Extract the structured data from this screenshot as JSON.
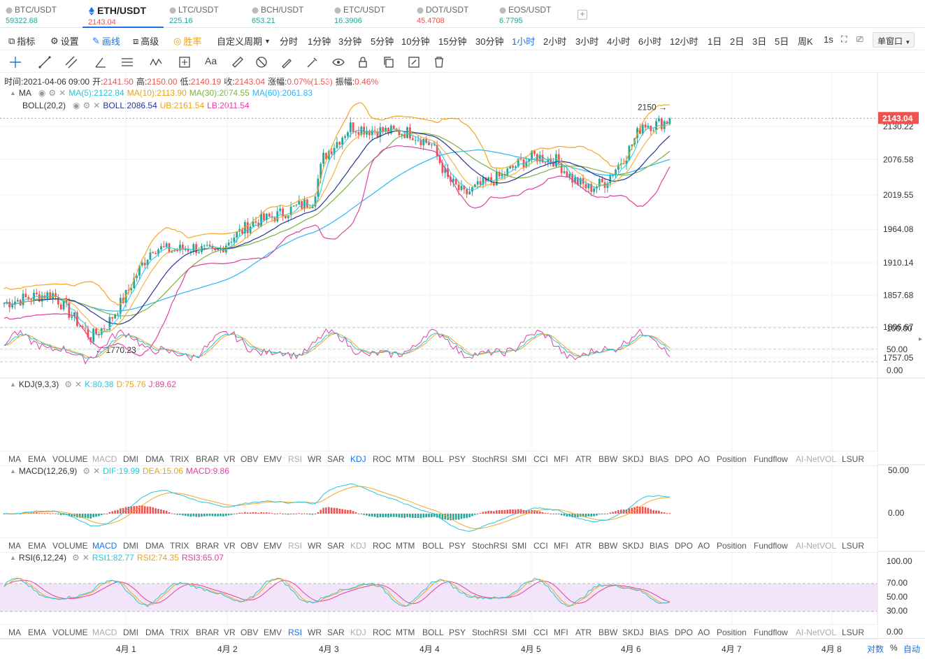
{
  "tabs": [
    {
      "name": "BTC/USDT",
      "price": "59322.68",
      "trend": "up",
      "icon": "bitcoin-icon"
    },
    {
      "name": "ETH/USDT",
      "price": "2143.04",
      "trend": "down",
      "icon": "ethereum-icon",
      "active": true
    },
    {
      "name": "LTC/USDT",
      "price": "225.16",
      "trend": "up",
      "icon": "litecoin-icon"
    },
    {
      "name": "BCH/USDT",
      "price": "653.21",
      "trend": "up",
      "icon": "bitcoin-cash-icon"
    },
    {
      "name": "ETC/USDT",
      "price": "16.3906",
      "trend": "up",
      "icon": "ethereum-classic-icon"
    },
    {
      "name": "DOT/USDT",
      "price": "45.4708",
      "trend": "down",
      "icon": "polkadot-icon"
    },
    {
      "name": "EOS/USDT",
      "price": "6.7795",
      "trend": "up",
      "icon": "eos-icon"
    }
  ],
  "toolbar": {
    "indicators": "指标",
    "settings": "设置",
    "draw": "画线",
    "advanced": "高级",
    "winrate": "胜率",
    "custom_period": "自定义周期",
    "periods": [
      "分时",
      "1分钟",
      "3分钟",
      "5分钟",
      "10分钟",
      "15分钟",
      "30分钟",
      "1小时",
      "2小时",
      "3小时",
      "4小时",
      "6小时",
      "12小时",
      "1日",
      "2日",
      "3日",
      "5日",
      "周K",
      "1s"
    ],
    "active_period": "1小时",
    "single_window": "单窗口"
  },
  "info": {
    "time_label": "时间:",
    "time": "2021-04-06 09:00",
    "open_label": "开:",
    "open": "2141.50",
    "high_label": "高:",
    "high": "2150.00",
    "low_label": "低:",
    "low": "2140.19",
    "close_label": "收:",
    "close": "2143.04",
    "change_label": "涨幅:",
    "change": "0.07%(1.53)",
    "amp_label": "振幅:",
    "amp": "0.46%"
  },
  "ma_legend": {
    "name": "MA",
    "ma5": "MA(5):2122.84",
    "ma10": "MA(10):2113.90",
    "ma30": "MA(30):2074.55",
    "ma60": "MA(60):2061.83"
  },
  "boll_legend": {
    "name": "BOLL(20,2)",
    "boll": "BOLL:2086.54",
    "ub": "UB:2161.54",
    "lb": "LB:2011.54"
  },
  "kdj_legend": {
    "name": "KDJ(9,3,3)",
    "k": "K:80.38",
    "d": "D:75.76",
    "j": "J:89.62"
  },
  "macd_legend": {
    "name": "MACD(12,26,9)",
    "dif": "DIF:19.99",
    "dea": "DEA:15.06",
    "macd": "MACD:9.86"
  },
  "rsi_legend": {
    "name": "RSI(6,12,24)",
    "rsi1": "RSI1:82.77",
    "rsi2": "RSI2:74.35",
    "rsi3": "RSI3:65.07"
  },
  "indicator_tabs": [
    "MA",
    "EMA",
    "VOLUME",
    "MACD",
    "DMI",
    "DMA",
    "TRIX",
    "BRAR",
    "VR",
    "OBV",
    "EMV",
    "RSI",
    "WR",
    "SAR",
    "KDJ",
    "ROC",
    "MTM",
    "BOLL",
    "PSY",
    "StochRSI",
    "SMI",
    "CCI",
    "MFI",
    "ATR",
    "BBW",
    "SKDJ",
    "BIAS",
    "DPO",
    "AO",
    "Position",
    "Fundflow",
    "AI-NetVOL",
    "LSUR"
  ],
  "xaxis": {
    "labels": [
      "4月 1",
      "4月 2",
      "4月 3",
      "4月 4",
      "4月 5",
      "4月 6",
      "4月 7",
      "4月 8"
    ],
    "log": "对数",
    "pct": "%",
    "auto": "自动"
  },
  "chart_data": {
    "type": "candlestick",
    "symbol": "ETH/USDT",
    "interval": "1小时",
    "price_axis": {
      "ticks": [
        "2143.04",
        "2130.22",
        "2076.58",
        "2019.55",
        "1964.08",
        "1910.14",
        "1857.68",
        "1806.67",
        "1757.05"
      ],
      "range": [
        1730,
        2185
      ]
    },
    "last_price": "2143.04",
    "annotations": {
      "high": "2150 →",
      "low": "← 1770.23"
    },
    "kdj_axis": [
      "100.00",
      "50.00",
      "0.00"
    ],
    "macd_axis": [
      "50.00",
      "0.00"
    ],
    "rsi_axis": [
      "100.00",
      "70.00",
      "50.00",
      "30.00",
      "0.00"
    ],
    "colors": {
      "up": "#26a69a",
      "down": "#ef5350",
      "ma5": "#26c6da",
      "ma10": "#f5a623",
      "ma30": "#7cb342",
      "ma60": "#29b6f6",
      "boll_mid": "#283593",
      "boll_ub": "#f5a623",
      "boll_lb": "#e040a0"
    }
  }
}
